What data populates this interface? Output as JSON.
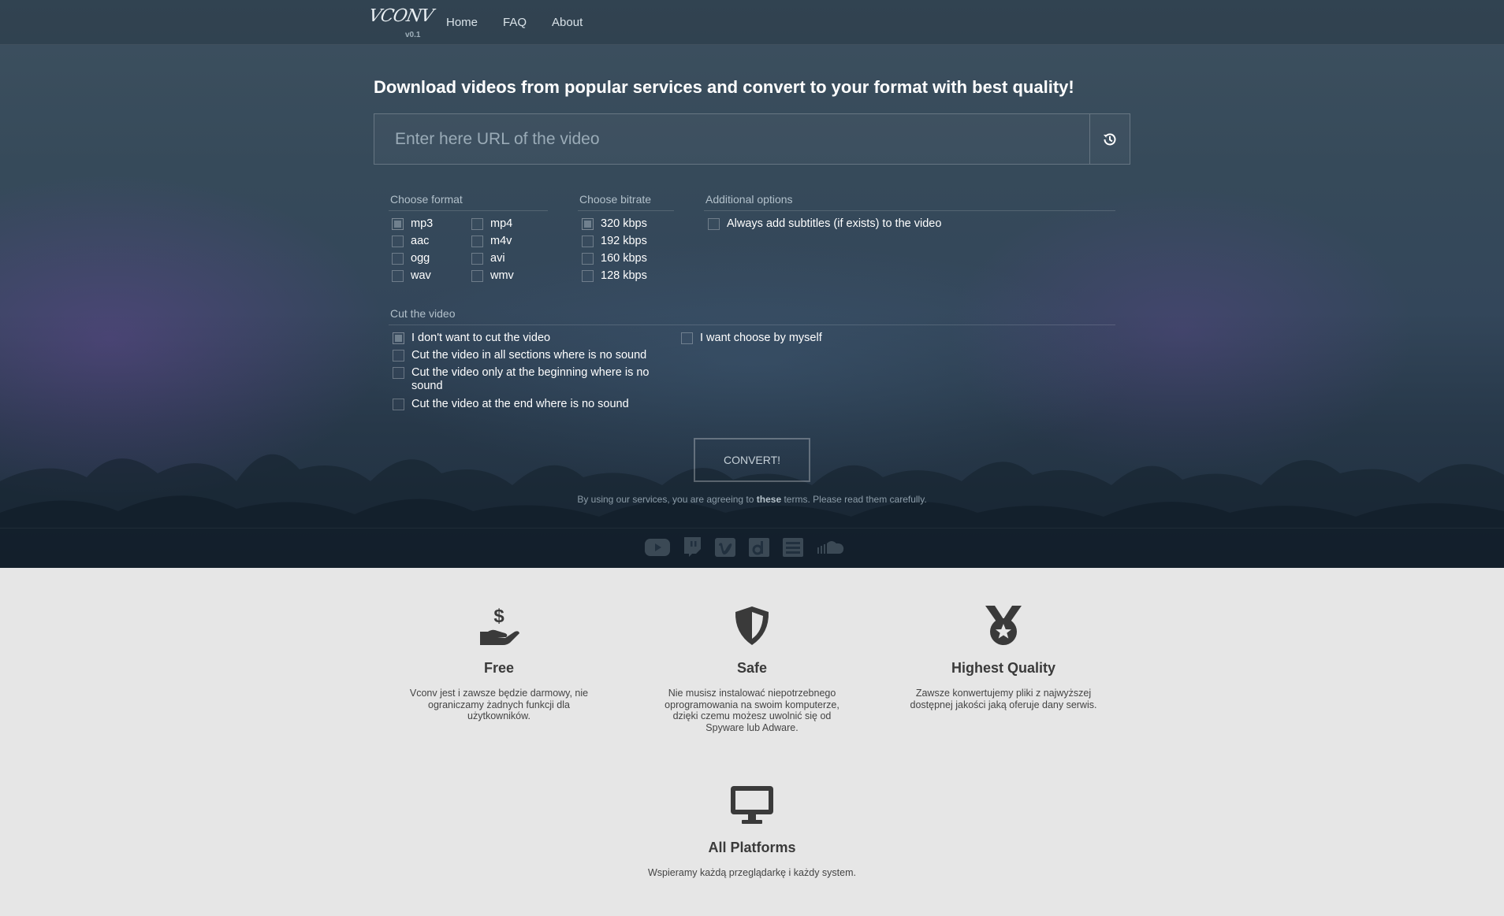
{
  "nav": {
    "logo_text": "VCONV",
    "version": "v0.1",
    "links": [
      "Home",
      "FAQ",
      "About"
    ]
  },
  "hero": {
    "headline": "Download videos from popular services and convert to your format with best quality!",
    "url_placeholder": "Enter here URL of the video",
    "url_value": ""
  },
  "format": {
    "title": "Choose format",
    "options": [
      {
        "label": "mp3",
        "checked": true
      },
      {
        "label": "aac",
        "checked": false
      },
      {
        "label": "ogg",
        "checked": false
      },
      {
        "label": "wav",
        "checked": false
      },
      {
        "label": "mp4",
        "checked": false
      },
      {
        "label": "m4v",
        "checked": false
      },
      {
        "label": "avi",
        "checked": false
      },
      {
        "label": "wmv",
        "checked": false
      }
    ]
  },
  "bitrate": {
    "title": "Choose bitrate",
    "options": [
      {
        "label": "320 kbps",
        "checked": true
      },
      {
        "label": "192 kbps",
        "checked": false
      },
      {
        "label": "160 kbps",
        "checked": false
      },
      {
        "label": "128 kbps",
        "checked": false
      }
    ]
  },
  "additional": {
    "title": "Additional options",
    "options": [
      {
        "label": "Always add subtitles (if exists) to the video",
        "checked": false
      }
    ]
  },
  "cut": {
    "title": "Cut the video",
    "options": [
      {
        "label": "I don't want to cut the video",
        "checked": true
      },
      {
        "label": "Cut the video in all sections where is no sound",
        "checked": false
      },
      {
        "label": "Cut the video only at the beginning where is no sound",
        "checked": false
      },
      {
        "label": "Cut the video at the end where is no sound",
        "checked": false
      },
      {
        "label": "I want choose by myself",
        "checked": false
      }
    ]
  },
  "convert_label": "CONVERT!",
  "terms": {
    "before": "By using our services, you are agreeing to ",
    "link": "these",
    "after": " terms. Please read them carefully."
  },
  "services": [
    "youtube-icon",
    "twitch-icon",
    "vimeo-icon",
    "dailymotion-icon",
    "youku-icon",
    "soundcloud-icon"
  ],
  "features": [
    {
      "icon": "hand-dollar-icon",
      "title": "Free",
      "desc": "Vconv jest i zawsze będzie darmowy, nie ograniczamy żadnych funkcji dla użytkowników."
    },
    {
      "icon": "shield-icon",
      "title": "Safe",
      "desc": "Nie musisz instalować niepotrzebnego oprogramowania na swoim komputerze, dzięki czemu możesz uwolnić się od Spyware lub Adware."
    },
    {
      "icon": "medal-icon",
      "title": "Highest Quality",
      "desc": "Zawsze konwertujemy pliki z najwyższej dostępnej jakości jaką oferuje dany serwis."
    },
    {
      "icon": "monitor-icon",
      "title": "All Platforms",
      "desc": "Wspieramy każdą przeglądarkę i każdy system."
    }
  ],
  "colors": {
    "feature_icon": "#3a3a3a",
    "page_bg": "#e6e6e6"
  }
}
